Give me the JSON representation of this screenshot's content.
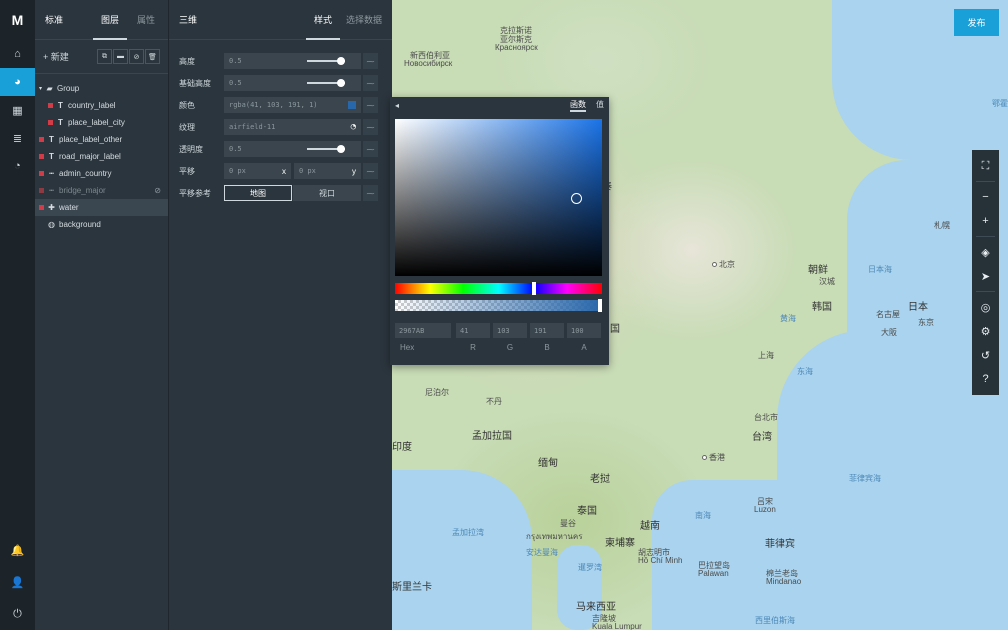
{
  "app": {
    "logo": "M",
    "publish_label": "发布"
  },
  "rail": {
    "items": [
      {
        "icon": "home-icon",
        "glyph": "⌂"
      },
      {
        "icon": "palette-icon",
        "glyph": "◕"
      },
      {
        "icon": "dashboard-icon",
        "glyph": "▦"
      },
      {
        "icon": "database-icon",
        "glyph": "≣"
      },
      {
        "icon": "pie-chart-icon",
        "glyph": "◔"
      }
    ],
    "bottom": [
      {
        "icon": "bell-icon",
        "glyph": "🔔"
      },
      {
        "icon": "user-icon",
        "glyph": "👤"
      },
      {
        "icon": "power-icon",
        "glyph": "⏻"
      }
    ]
  },
  "layers_panel": {
    "title": "标准",
    "tabs": [
      "图层",
      "属性"
    ],
    "new_label": "新建",
    "tools": [
      "⧉",
      "▬",
      "⊘",
      "🗑"
    ],
    "items": [
      {
        "label": "Group",
        "type": "folder",
        "swatch": false
      },
      {
        "label": "country_label",
        "type": "T",
        "swatch": true
      },
      {
        "label": "place_label_city",
        "type": "T",
        "swatch": true
      },
      {
        "label": "place_label_other",
        "type": "T",
        "swatch": true
      },
      {
        "label": "road_major_label",
        "type": "T",
        "swatch": true
      },
      {
        "label": "admin_country",
        "type": "line",
        "swatch": true
      },
      {
        "label": "bridge_major",
        "type": "line",
        "swatch": true
      },
      {
        "label": "water",
        "type": "fill",
        "swatch": true
      },
      {
        "label": "background",
        "type": "globe",
        "swatch": false
      }
    ]
  },
  "props_panel": {
    "title": "三维",
    "tabs": [
      "样式",
      "选择数据"
    ],
    "rows": {
      "height": {
        "label": "高度",
        "value": "0.5"
      },
      "base_height": {
        "label": "基础高度",
        "value": "0.5"
      },
      "color": {
        "label": "颜色",
        "value": "rgba(41, 103, 191, 1)"
      },
      "texture": {
        "label": "纹理",
        "value": "airfield-11"
      },
      "opacity": {
        "label": "透明度",
        "value": "0.5"
      },
      "translate": {
        "label": "平移",
        "x_placeholder": "0 px",
        "x_unit": "x",
        "y_placeholder": "0 px",
        "y_unit": "y"
      },
      "translate_ref": {
        "label": "平移参考",
        "options": [
          "地图",
          "视口"
        ],
        "selected": "地图"
      }
    }
  },
  "color_picker": {
    "tabs": [
      "函数",
      "值"
    ],
    "selected_tab": "函数",
    "hex": "2967AB",
    "r": "41",
    "g": "103",
    "b": "191",
    "a": "100",
    "captions": [
      "Hex",
      "R",
      "G",
      "B",
      "A"
    ]
  },
  "map_labels": [
    {
      "text": "克拉斯诺亚尔斯克",
      "kind": "normal"
    },
    {
      "text": "克拉斯诺",
      "kind": "normal"
    },
    {
      "text": "亚尔斯克",
      "kind": "normal"
    },
    {
      "text": "Красноярск",
      "kind": "normal"
    },
    {
      "text": "新西伯利亚",
      "kind": "normal"
    },
    {
      "text": "Новосибирск",
      "kind": "normal"
    },
    {
      "text": "鄂霍",
      "kind": "sea"
    },
    {
      "text": "北京",
      "kind": "normal"
    },
    {
      "text": "朝鲜",
      "kind": "big"
    },
    {
      "text": "汉城",
      "kind": "normal"
    },
    {
      "text": "韩国",
      "kind": "big"
    },
    {
      "text": "日本海",
      "kind": "sea"
    },
    {
      "text": "札幌",
      "kind": "normal"
    },
    {
      "text": "日本",
      "kind": "big"
    },
    {
      "text": "名古屋",
      "kind": "normal"
    },
    {
      "text": "东京",
      "kind": "normal"
    },
    {
      "text": "大阪",
      "kind": "normal"
    },
    {
      "text": "黄海",
      "kind": "sea"
    },
    {
      "text": "上海",
      "kind": "normal"
    },
    {
      "text": "东海",
      "kind": "sea"
    },
    {
      "text": "国",
      "kind": "big"
    },
    {
      "text": "台北市",
      "kind": "normal"
    },
    {
      "text": "台湾",
      "kind": "big"
    },
    {
      "text": "香港",
      "kind": "normal"
    },
    {
      "text": "尼泊尔",
      "kind": "normal"
    },
    {
      "text": "不丹",
      "kind": "normal"
    },
    {
      "text": "印度",
      "kind": "big"
    },
    {
      "text": "孟加拉国",
      "kind": "big"
    },
    {
      "text": "缅甸",
      "kind": "big"
    },
    {
      "text": "老挝",
      "kind": "big"
    },
    {
      "text": "泰国",
      "kind": "big"
    },
    {
      "text": "越南",
      "kind": "big"
    },
    {
      "text": "柬埔寨",
      "kind": "big"
    },
    {
      "text": "曼谷",
      "kind": "normal"
    },
    {
      "text": "กรุงเทพมหานคร",
      "kind": "normal"
    },
    {
      "text": "胡志明市",
      "kind": "normal"
    },
    {
      "text": "Hồ Chí Minh",
      "kind": "normal"
    },
    {
      "text": "孟加拉湾",
      "kind": "sea"
    },
    {
      "text": "安达曼海",
      "kind": "sea"
    },
    {
      "text": "暹罗湾",
      "kind": "sea"
    },
    {
      "text": "南海",
      "kind": "sea"
    },
    {
      "text": "菲律宾海",
      "kind": "sea"
    },
    {
      "text": "吕宋",
      "kind": "normal"
    },
    {
      "text": "Luzon",
      "kind": "normal"
    },
    {
      "text": "菲律宾",
      "kind": "big"
    },
    {
      "text": "巴拉望岛",
      "kind": "normal"
    },
    {
      "text": "Palawan",
      "kind": "normal"
    },
    {
      "text": "棉兰老岛",
      "kind": "normal"
    },
    {
      "text": "Mindanao",
      "kind": "normal"
    },
    {
      "text": "马来西亚",
      "kind": "big"
    },
    {
      "text": "吉隆坡",
      "kind": "normal"
    },
    {
      "text": "Kuala Lumpur",
      "kind": "normal"
    },
    {
      "text": "斯里兰卡",
      "kind": "big"
    },
    {
      "text": "西里伯斯海",
      "kind": "sea"
    },
    {
      "text": "泰",
      "kind": "big"
    }
  ],
  "map_controls": [
    "⛶",
    "−",
    "+",
    "◈",
    "➤",
    "◎",
    "⚙",
    "↺",
    "?"
  ],
  "colors": {
    "accent": "#1aa0d8",
    "layer_swatch": "#d23c48",
    "fill_color": "#2967ab"
  }
}
